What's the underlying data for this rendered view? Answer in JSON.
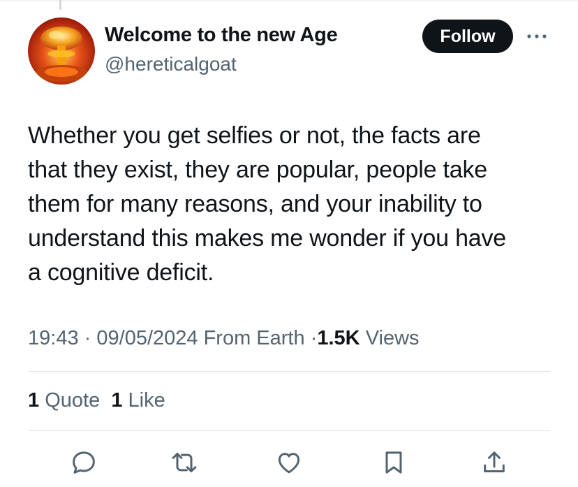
{
  "author": {
    "display_name": "Welcome to the new Age",
    "handle": "@hereticalgoat",
    "avatar_icon": "nuclear-explosion-avatar"
  },
  "follow_label": "Follow",
  "more_icon": "more-options-icon",
  "tweet": {
    "lines": [
      "Whether you get selfies or not, the facts are",
      "that they exist, they are popular, people take",
      "them for many reasons, and your inability to",
      "understand this makes me wonder if you have",
      "a cognitive deficit."
    ]
  },
  "meta": {
    "time": "19:43",
    "separator": "·",
    "date": "09/05/2024",
    "source": "From Earth",
    "views_count": "1.5K",
    "views_label": "Views"
  },
  "stats": {
    "quotes_count": "1",
    "quotes_label": "Quote",
    "likes_count": "1",
    "likes_label": "Like"
  },
  "actions": [
    "reply-icon",
    "retweet-icon",
    "like-icon",
    "bookmark-icon",
    "share-icon"
  ],
  "colors": {
    "text": "#0f1419",
    "secondary": "#536471",
    "button_bg": "#0f1419",
    "divider": "#dfe4e7"
  }
}
